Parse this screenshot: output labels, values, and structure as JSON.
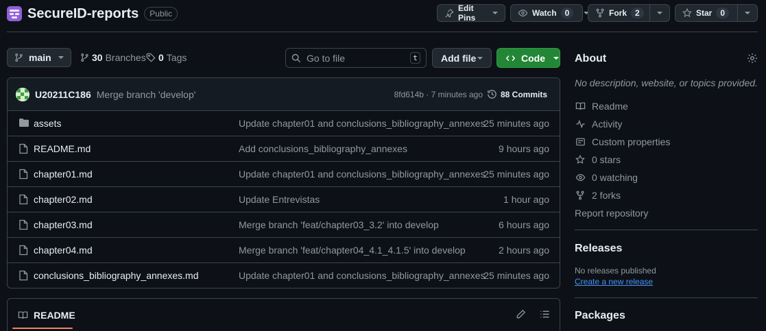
{
  "header": {
    "repo_name": "SecureID-reports",
    "visibility": "Public",
    "edit_pins": "Edit Pins",
    "watch_label": "Watch",
    "watch_count": "0",
    "fork_label": "Fork",
    "fork_count": "2",
    "star_label": "Star",
    "star_count": "0"
  },
  "toolbar": {
    "branch": "main",
    "branches_count": "30",
    "branches_label": "Branches",
    "tags_count": "0",
    "tags_label": "Tags",
    "search_placeholder": "Go to file",
    "search_shortcut": "t",
    "add_file": "Add file",
    "code": "Code"
  },
  "commit": {
    "user": "U20211C186",
    "message": "Merge branch 'develop'",
    "meta": "8fd614b · 7 minutes ago",
    "count_label": "88 Commits"
  },
  "files": [
    {
      "name": "assets",
      "type": "folder",
      "message": "Update chapter01 and conclusions_bibliography_annexes",
      "time": "25 minutes ago"
    },
    {
      "name": "README.md",
      "type": "file",
      "message": "Add conclusions_bibliography_annexes",
      "time": "9 hours ago"
    },
    {
      "name": "chapter01.md",
      "type": "file",
      "message": "Update chapter01 and conclusions_bibliography_annexes",
      "time": "25 minutes ago"
    },
    {
      "name": "chapter02.md",
      "type": "file",
      "message": "Update Entrevistas",
      "time": "1 hour ago"
    },
    {
      "name": "chapter03.md",
      "type": "file",
      "message": "Merge branch 'feat/chapter03_3.2' into develop",
      "time": "6 hours ago"
    },
    {
      "name": "chapter04.md",
      "type": "file",
      "message": "Merge branch 'feat/chapter04_4.1_4.1.5' into develop",
      "time": "2 hours ago"
    },
    {
      "name": "conclusions_bibliography_annexes.md",
      "type": "file",
      "message": "Update chapter01 and conclusions_bibliography_annexes",
      "time": "25 minutes ago"
    }
  ],
  "readme": {
    "tab_label": "README"
  },
  "sidebar": {
    "about_title": "About",
    "description": "No description, website, or topics provided.",
    "items": [
      {
        "label": "Readme",
        "icon": "book-icon"
      },
      {
        "label": "Activity",
        "icon": "pulse-icon"
      },
      {
        "label": "Custom properties",
        "icon": "note-icon"
      },
      {
        "label": "0 stars",
        "icon": "star-icon"
      },
      {
        "label": "0 watching",
        "icon": "eye-icon"
      },
      {
        "label": "2 forks",
        "icon": "fork-icon"
      }
    ],
    "report": "Report repository",
    "releases_title": "Releases",
    "no_releases": "No releases published",
    "create_release": "Create a new release",
    "packages_title": "Packages"
  },
  "colors": {
    "background": "#0d1117",
    "border": "#3d444d",
    "code_button": "#238636",
    "link": "#4493f8",
    "logo": "#8f62d6"
  }
}
